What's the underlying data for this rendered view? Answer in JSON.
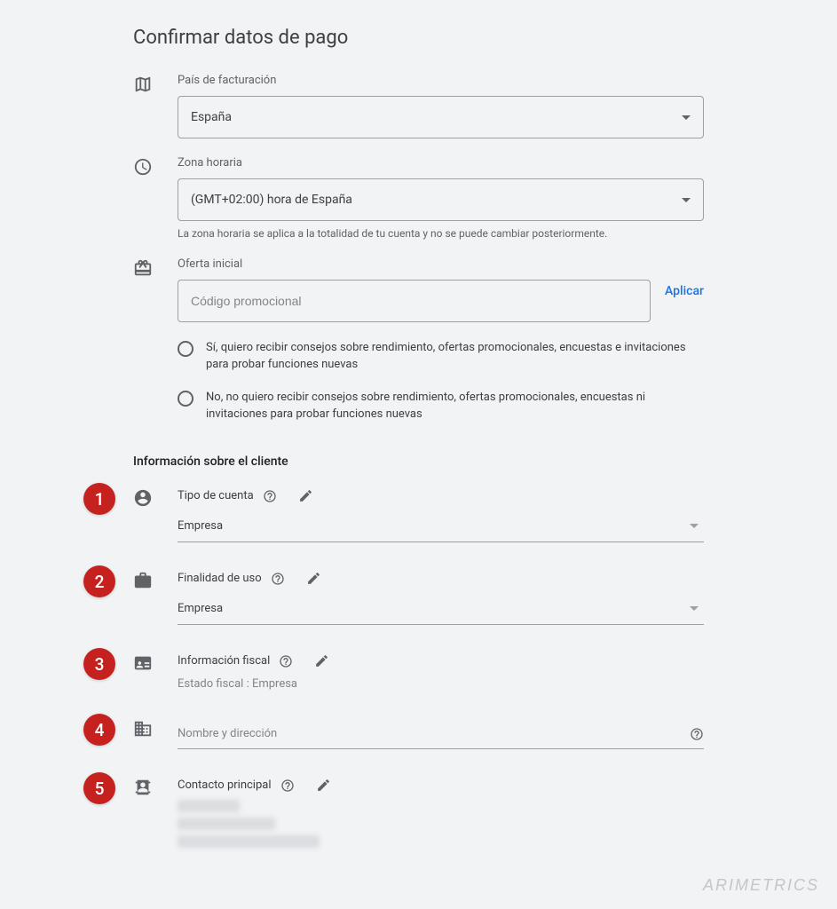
{
  "page": {
    "title": "Confirmar datos de pago"
  },
  "billing_country": {
    "label": "País de facturación",
    "value": "España"
  },
  "timezone": {
    "label": "Zona horaria",
    "value": "(GMT+02:00) hora de España",
    "helper": "La zona horaria se aplica a la totalidad de tu cuenta y no se puede cambiar posteriormente."
  },
  "offer": {
    "label": "Oferta inicial",
    "placeholder": "Código promocional",
    "apply": "Aplicar"
  },
  "marketing": {
    "yes": "Sí, quiero recibir consejos sobre rendimiento, ofertas promocionales, encuestas e invitaciones para probar funciones nuevas",
    "no": "No, no quiero recibir consejos sobre rendimiento, ofertas promocionales, encuestas ni invitaciones para probar funciones nuevas"
  },
  "customer_section": {
    "title": "Información sobre el cliente"
  },
  "items": {
    "account_type": {
      "badge": "1",
      "label": "Tipo de cuenta",
      "value": "Empresa"
    },
    "purpose": {
      "badge": "2",
      "label": "Finalidad de uso",
      "value": "Empresa"
    },
    "tax": {
      "badge": "3",
      "label": "Información fiscal",
      "status_label": "Estado fiscal :",
      "status_value": "Empresa"
    },
    "address": {
      "badge": "4",
      "label": "Nombre y dirección"
    },
    "contact": {
      "badge": "5",
      "label": "Contacto principal"
    }
  },
  "watermark": "ARIMETRICS"
}
